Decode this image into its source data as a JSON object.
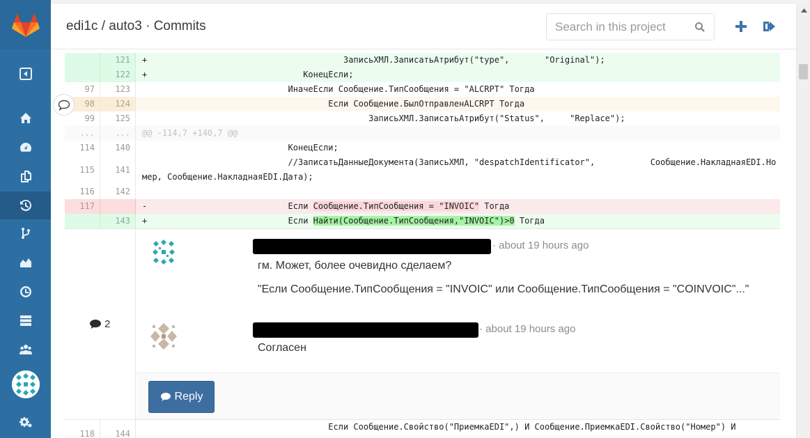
{
  "header": {
    "title": "edi1c / auto3 · Commits",
    "search_placeholder": "Search in this project"
  },
  "sidebar": {
    "items": [
      "sidebar-toggle-icon",
      "home-icon",
      "dashboard-icon",
      "files-icon",
      "history-icon",
      "branch-icon",
      "graph-icon",
      "clock-icon",
      "server-icon",
      "users-icon",
      "settings-icon"
    ],
    "active": "history-icon"
  },
  "diff": {
    "rows": [
      {
        "type": "add",
        "old": "",
        "new": "121",
        "code": "+                                       ЗаписьХМЛ.ЗаписатьАтрибут(\"type\",       \"Original\");"
      },
      {
        "type": "add",
        "old": "",
        "new": "122",
        "code": "+                               КонецЕсли;"
      },
      {
        "type": "ctx",
        "old": "97",
        "new": "123",
        "code": "                             ИначеЕсли Сообщение.ТипСообщения = \"ALCRPT\" Тогда"
      },
      {
        "type": "hl",
        "old": "98",
        "new": "124",
        "code": "                                     Если Сообщение.БылОтправленALCRPT Тогда"
      },
      {
        "type": "ctx",
        "old": "99",
        "new": "125",
        "code": "                                             ЗаписьХМЛ.ЗаписатьАтрибут(\"Status\",     \"Replace\");"
      },
      {
        "type": "meta",
        "old": "...",
        "new": "...",
        "code": "@@ -114,7 +140,7 @@"
      },
      {
        "type": "ctx",
        "old": "114",
        "new": "140",
        "code": "                             КонецЕсли;"
      },
      {
        "type": "tall",
        "old": "115",
        "new": "141",
        "code": "                             //ЗаписатьДанныеДокумента(ЗаписьХМЛ, \"despatchIdentificator\",           Сообщение.НакладнаяEDI.Номер, Сообщение.НакладнаяEDI.Дата);"
      },
      {
        "type": "ctx",
        "old": "116",
        "new": "142",
        "code": ""
      }
    ],
    "del_row": {
      "old": "117",
      "prefix": "-                            Если ",
      "mark": "Сообщение.ТипСообщения = \"INVOIC\"",
      "suffix": " Тогда"
    },
    "add_row": {
      "new": "143",
      "prefix": "+                            Если ",
      "mark": "Найти(Сообщение.ТипСообщения,\"INVOIC\")>0",
      "suffix": " Тогда"
    },
    "last_row": {
      "old": "118",
      "new": "144",
      "code": "                                     Если Сообщение.Свойство(\"ПриемкаEDI\",) И Сообщение.ПриемкаEDI.Свойство(\"Номер\") И"
    }
  },
  "discussion": {
    "count": "2",
    "notes": [
      {
        "time": "· about 19 hours ago",
        "lines": [
          "гм. Может, более очевидно сделаем?",
          "\"Если Сообщение.ТипСообщения = \"INVOIC\" или Сообщение.ТипСообщения = \"COINVOIC\"...\""
        ]
      },
      {
        "time": "· about 19 hours ago",
        "lines": [
          "Согласен"
        ]
      }
    ],
    "reply_label": "Reply"
  }
}
